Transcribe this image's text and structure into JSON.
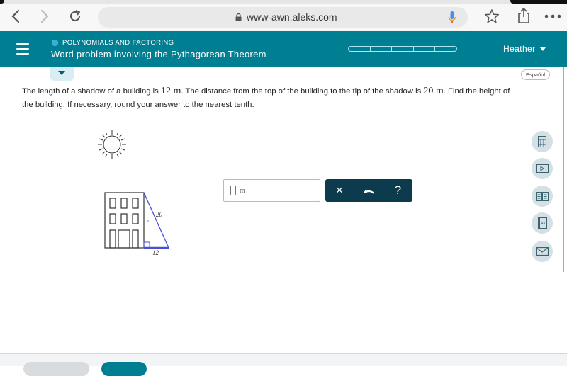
{
  "browser": {
    "url": "www-awn.aleks.com",
    "back_icon": "chevron-left-icon",
    "forward_icon": "chevron-right-icon",
    "reload_icon": "reload-icon",
    "lock_icon": "lock-icon",
    "mic_icon": "microphone-icon",
    "bookmark_icon": "star-icon",
    "share_icon": "share-icon",
    "more_icon": "more-icon"
  },
  "header": {
    "topic": "POLYNOMIALS AND FACTORING",
    "title": "Word problem involving the Pythagorean Theorem",
    "user": "Heather",
    "progress_segments": 5,
    "progress_filled": 0,
    "colors": {
      "brand": "#007f93",
      "dark": "#0b3b4c"
    }
  },
  "language_button": "Español",
  "problem": {
    "part1": "The length of a shadow of a building is ",
    "shadow_value": "12 m",
    "part2": ". The distance from the top of the building to the tip of the shadow is ",
    "distance_value": "20 m",
    "part3": ". Find the height of the building. If necessary, round your answer to the nearest tenth."
  },
  "figure": {
    "hypotenuse_label": "20",
    "height_label": "?",
    "base_label": "12"
  },
  "answer": {
    "value": "",
    "unit": "m",
    "clear_label": "×",
    "undo_icon": "undo-icon",
    "help_label": "?"
  },
  "side_tools": [
    "calculator-icon",
    "video-icon",
    "ebook-icon",
    "dictionary-icon",
    "message-icon"
  ]
}
